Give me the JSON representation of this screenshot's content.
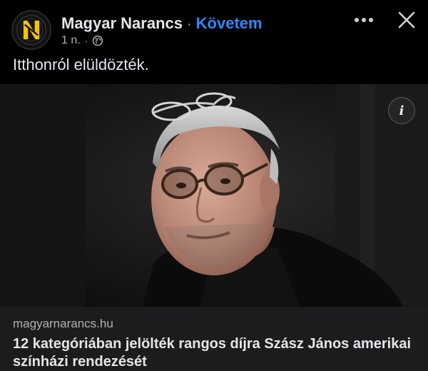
{
  "post": {
    "page_name": "Magyar Narancs",
    "separator": "·",
    "follow_label": "Követem",
    "timestamp": "1 n.",
    "meta_separator": "·",
    "privacy_icon": "globe-icon",
    "text": "Itthonról elüldözték."
  },
  "header_actions": {
    "more_icon": "more-horizontal-icon",
    "close_icon": "close-icon"
  },
  "link_preview": {
    "info_icon_glyph": "i",
    "domain": "magyarnarancs.hu",
    "title": "12 kategóriában jelölték rangos díjra Szász János amerikai színházi rendezését"
  },
  "colors": {
    "background": "#000000",
    "text_primary": "#e4e6eb",
    "text_secondary": "#b0b3b8",
    "accent_link": "#2d88ff",
    "card_footer": "#1c1c1e",
    "logo_yellow": "#f5c400"
  }
}
